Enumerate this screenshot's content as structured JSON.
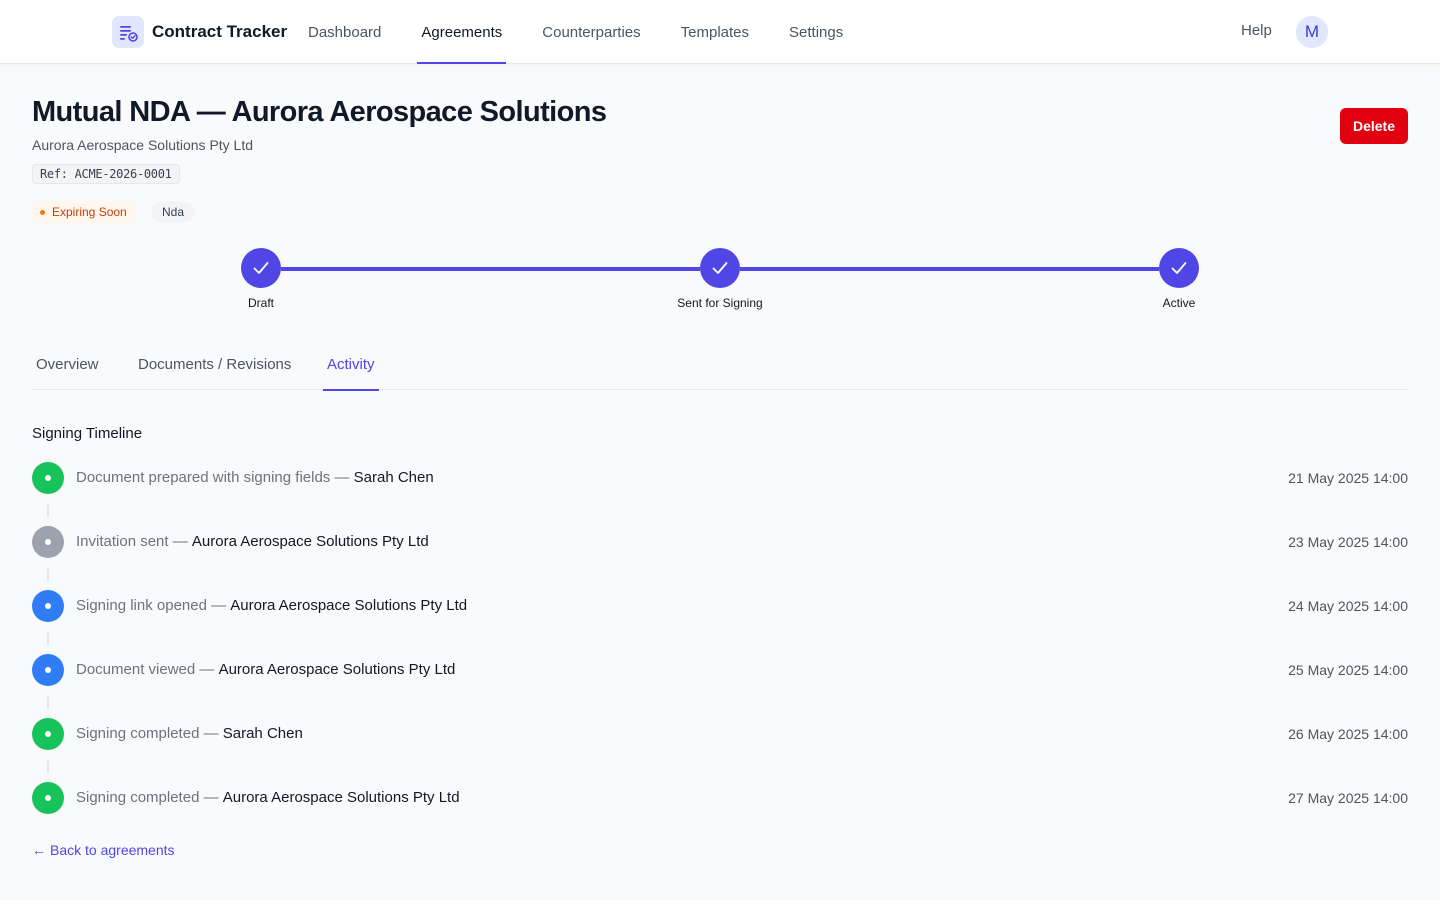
{
  "app": {
    "name": "Contract Tracker",
    "logo_icon": "contract-doc-icon"
  },
  "nav": {
    "items": [
      {
        "label": "Dashboard",
        "active": false
      },
      {
        "label": "Agreements",
        "active": true
      },
      {
        "label": "Counterparties",
        "active": false
      },
      {
        "label": "Templates",
        "active": false
      },
      {
        "label": "Settings",
        "active": false
      }
    ],
    "help_label": "Help",
    "avatar_initial": "M"
  },
  "agreement": {
    "title": "Mutual NDA — Aurora Aerospace Solutions",
    "counterparty": "Aurora Aerospace Solutions Pty Ltd",
    "reference": "Ref: ACME-2026-0001",
    "status_badge": "Expiring Soon",
    "type_badge": "Nda",
    "delete_label": "Delete"
  },
  "stepper": {
    "steps": [
      {
        "label": "Draft",
        "complete": true
      },
      {
        "label": "Sent for Signing",
        "complete": true
      },
      {
        "label": "Active",
        "complete": true
      }
    ]
  },
  "tabs": {
    "items": [
      {
        "label": "Overview",
        "active": false
      },
      {
        "label": "Documents / Revisions",
        "active": false
      },
      {
        "label": "Activity",
        "active": true
      }
    ]
  },
  "timeline": {
    "title": "Signing Timeline",
    "events": [
      {
        "action": "Document prepared with signing fields — ",
        "actor": "Sarah Chen",
        "time": "21 May 2025 14:00",
        "color": "#16c25a"
      },
      {
        "action": "Invitation sent — ",
        "actor": "Aurora Aerospace Solutions Pty Ltd",
        "time": "23 May 2025 14:00",
        "color": "#9ca3af"
      },
      {
        "action": "Signing link opened — ",
        "actor": "Aurora Aerospace Solutions Pty Ltd",
        "time": "24 May 2025 14:00",
        "color": "#2f7cf6"
      },
      {
        "action": "Document viewed — ",
        "actor": "Aurora Aerospace Solutions Pty Ltd",
        "time": "25 May 2025 14:00",
        "color": "#2f7cf6"
      },
      {
        "action": "Signing completed — ",
        "actor": "Sarah Chen",
        "time": "26 May 2025 14:00",
        "color": "#16c25a"
      },
      {
        "action": "Signing completed — ",
        "actor": "Aurora Aerospace Solutions Pty Ltd",
        "time": "27 May 2025 14:00",
        "color": "#16c25a"
      }
    ]
  },
  "back_link": {
    "arrow": "←",
    "label": "Back to agreements"
  },
  "colors": {
    "accent": "#4f46e5",
    "danger": "#e00010",
    "warning": "#c2410c",
    "success": "#16c25a",
    "info": "#2f7cf6",
    "neutral": "#9ca3af"
  }
}
